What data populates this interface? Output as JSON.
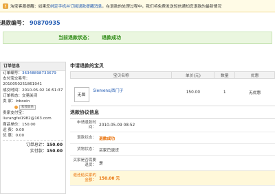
{
  "notice": {
    "text_pre": "淘宝客服提醒：如果您",
    "text_link": "绑定手机并订阅退款提醒消息",
    "text_post": "，在退款的处理过程中，我们将免费发送短信通知您退款的最新情况"
  },
  "refund": {
    "label": "退款编号：",
    "number": "90870935"
  },
  "status": {
    "label": "当前退款状态：",
    "value": "退款成功"
  },
  "order": {
    "title": "订单信息",
    "order_no_label": "订单编号：",
    "order_no": "36348898733679",
    "trade_label": "支付宝交易号：",
    "trade_no": "2010050251861941",
    "deal_time": "成交时间：2010-05-02 16:51:37",
    "order_status": "订单状态：交易关闭",
    "seller": "卖 家：Inbooin",
    "seller_contact": "和我联系",
    "seller_alipay_label": "卖家支付宝：",
    "seller_alipay": "liurangfei1982@163.com",
    "unit_price": "商品单价：150.00",
    "shipping": "运    费：0.00",
    "discount": "优    惠：0.00",
    "total_label": "订单总计：",
    "total": "150.00",
    "paid_label": "实付款：",
    "paid": "150.00"
  },
  "goods": {
    "title": "申请退款的宝贝",
    "headers": [
      "宝贝名称",
      "单价(元)",
      "数量",
      "优惠"
    ],
    "thumb": "无图",
    "name": "Siemens/西门子",
    "price": "150.00",
    "qty": "1",
    "discount": "无优惠"
  },
  "protocol": {
    "title": "退款协议信息",
    "apply_time_label": "申请退款时间：",
    "apply_time": "2010-05-09 08:52",
    "refund_status_label": "退款状态：",
    "refund_status": "退款成功",
    "goods_status_label": "货物状态：",
    "goods_status": "买家已退货",
    "need_return_label": "买家是否需要退货：",
    "need_return": "是",
    "amount_label": "退还给买家的金额：",
    "amount": "150.00 元"
  }
}
